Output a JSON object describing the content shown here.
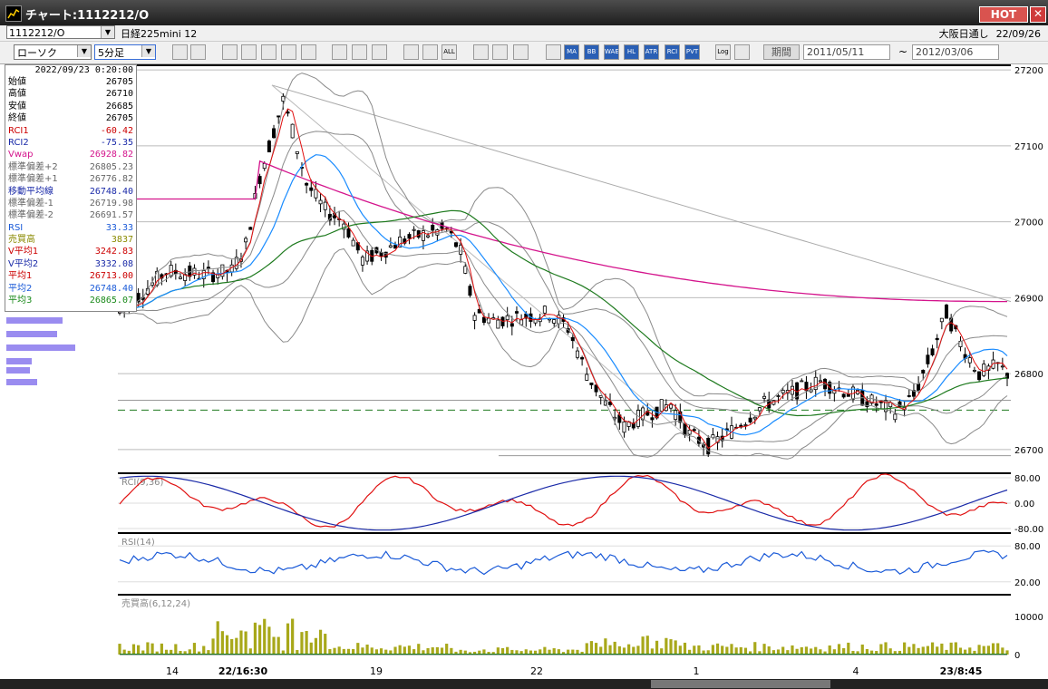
{
  "window": {
    "title": "チャート:1112212/O",
    "hot_label": "HOT",
    "close_glyph": "✕"
  },
  "symbol_bar": {
    "symbol": "1112212/O",
    "contract": "日経225mini 12",
    "market": "大阪日通し",
    "date": "22/09/26"
  },
  "toolbar": {
    "chart_type": "ローソク",
    "interval": "5分足",
    "buttons": [
      "zoom",
      "cursor",
      "bull",
      "ichimoku",
      "pnf",
      "kagi",
      "grid",
      "edit",
      "select",
      "redo",
      "bar",
      "line",
      "ALL",
      "gear",
      "wrench",
      "color",
      "ma_table",
      "MA",
      "BB",
      "VWE",
      "HL",
      "ATR",
      "RCI",
      "PVT",
      "Log",
      "export"
    ],
    "period_label": "期間",
    "date_from": "2011/05/11",
    "tilde": "~",
    "date_to": "2012/03/06"
  },
  "info_panel": {
    "timestamp": "2022/09/23 0:20:00",
    "rows": [
      {
        "label": "始値",
        "value": "26705",
        "color": "#000000"
      },
      {
        "label": "高値",
        "value": "26710",
        "color": "#000000"
      },
      {
        "label": "安値",
        "value": "26685",
        "color": "#000000"
      },
      {
        "label": "終値",
        "value": "26705",
        "color": "#000000"
      },
      {
        "label": "RCI1",
        "value": "-60.42",
        "color": "#cc0000"
      },
      {
        "label": "RCI2",
        "value": "-75.35",
        "color": "#1a2aa8"
      },
      {
        "label": "Vwap",
        "value": "26928.82",
        "color": "#d4148c"
      },
      {
        "label": "標準偏差+2",
        "value": "26805.23",
        "color": "#666666"
      },
      {
        "label": "標準偏差+1",
        "value": "26776.82",
        "color": "#666666"
      },
      {
        "label": "移動平均線",
        "value": "26748.40",
        "color": "#1a2aa8"
      },
      {
        "label": "標準偏差-1",
        "value": "26719.98",
        "color": "#666666"
      },
      {
        "label": "標準偏差-2",
        "value": "26691.57",
        "color": "#666666"
      },
      {
        "label": "RSI",
        "value": "33.33",
        "color": "#1a5ad8"
      },
      {
        "label": "売買高",
        "value": "3837",
        "color": "#8a8a00"
      },
      {
        "label": "V平均1",
        "value": "3242.83",
        "color": "#cc0000"
      },
      {
        "label": "V平均2",
        "value": "3332.08",
        "color": "#1a2aa8"
      },
      {
        "label": "平均1",
        "value": "26713.00",
        "color": "#cc0000"
      },
      {
        "label": "平均2",
        "value": "26748.40",
        "color": "#1a5ad8"
      },
      {
        "label": "平均3",
        "value": "26865.07",
        "color": "#1a8a1a"
      }
    ]
  },
  "chart_data": {
    "type": "candlestick",
    "price_axis": {
      "ticks": [
        "27200",
        "27100",
        "27000",
        "26900",
        "26800",
        "26700"
      ],
      "range": [
        26670,
        27205
      ]
    },
    "time_labels": [
      "14",
      "22/16:30",
      "19",
      "22",
      "1",
      "4",
      "23/8:45"
    ],
    "panel_truncated_label": "足",
    "rci": {
      "label": "RCI(9,36)",
      "ticks": [
        "80.00",
        "0.00",
        "-80.00"
      ]
    },
    "rsi": {
      "label": "RSI(14)",
      "ticks": [
        "80.00",
        "20.00"
      ]
    },
    "volume": {
      "label": "売買高(6,12,24)",
      "ticks": [
        "10000",
        "0"
      ]
    }
  },
  "colors": {
    "vwap": "#d4148c",
    "ma_blue": "#1a8cff",
    "ma_green": "#1e7a1e",
    "ma_red": "#e01010",
    "band": "#8a8a8a",
    "volume": "#a8a81a",
    "profile": "#9a8cf0"
  }
}
